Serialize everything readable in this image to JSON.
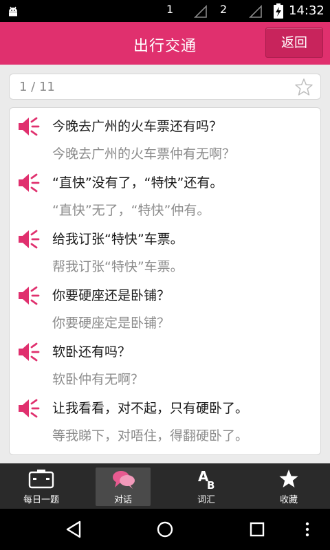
{
  "status_bar": {
    "sim1": "1",
    "sim2": "2",
    "time": "14:32"
  },
  "header": {
    "title": "出行交通",
    "back_label": "返回"
  },
  "counter": {
    "text": "1 / 11"
  },
  "phrases": [
    {
      "mandarin": "今晚去广州的火车票还有吗？",
      "cantonese": "今晚去广州的火车票仲有无啊？"
    },
    {
      "mandarin": "“直快”没有了，“特快”还有。",
      "cantonese": "“直快”无了，“特快”仲有。"
    },
    {
      "mandarin": "给我订张“特快”车票。",
      "cantonese": "帮我订张“特快”车票。"
    },
    {
      "mandarin": "你要硬座还是卧铺？",
      "cantonese": "你要硬座定是卧铺？"
    },
    {
      "mandarin": "软卧还有吗？",
      "cantonese": "软卧仲有无啊？"
    },
    {
      "mandarin": "让我看看，对不起，只有硬卧了。",
      "cantonese": "等我睇下，对唔住，得翻硬卧了。"
    }
  ],
  "tabs": [
    {
      "label": "每日一题",
      "icon": "daily-question-icon"
    },
    {
      "label": "对话",
      "icon": "dialogue-icon"
    },
    {
      "label": "词汇",
      "icon": "vocabulary-icon"
    },
    {
      "label": "收藏",
      "icon": "star-icon"
    }
  ],
  "colors": {
    "accent": "#e0306e",
    "back_button": "#c8245c",
    "tab_bar": "#2a2a2a"
  }
}
